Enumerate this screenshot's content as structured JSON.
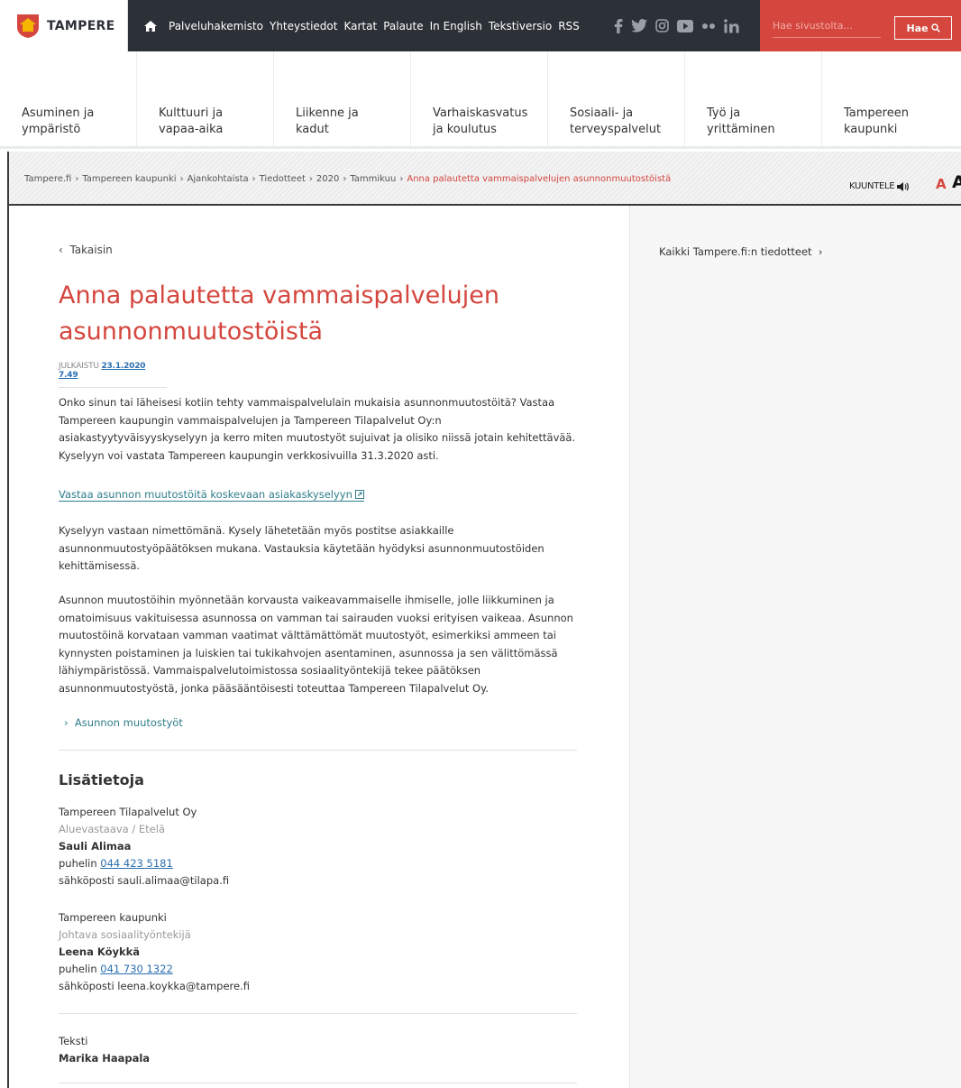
{
  "header": {
    "logo_text": "TAMPERE",
    "top_links": [
      "Palveluhakemisto",
      "Yhteystiedot",
      "Kartat",
      "Palaute",
      "In English",
      "Tekstiversio",
      "RSS"
    ],
    "search_placeholder": "Hae sivustolta...",
    "search_button": "Hae",
    "colors": {
      "topbar": "#2c3037",
      "search_bg": "#d4463e"
    }
  },
  "nav": {
    "items": [
      {
        "line1": "Asuminen ja",
        "line2": "ympäristö"
      },
      {
        "line1": "Kulttuuri ja",
        "line2": "vapaa-aika"
      },
      {
        "line1": "Liikenne ja",
        "line2": "kadut"
      },
      {
        "line1": "Varhaiskasvatus",
        "line2": "ja koulutus"
      },
      {
        "line1": "Sosiaali- ja",
        "line2": "terveyspalvelut"
      },
      {
        "line1": "Työ ja",
        "line2": "yrittäminen"
      },
      {
        "line1": "Tampereen",
        "line2": "kaupunki"
      }
    ]
  },
  "breadcrumb": {
    "items": [
      "Tampere.fi",
      "Tampereen kaupunki",
      "Ajankohtaista",
      "Tiedotteet",
      "2020",
      "Tammikuu"
    ],
    "current": "Anna palautetta vammaispalvelujen asunnonmuutostöistä",
    "listen": "KUUNTELE",
    "font_small": "A",
    "font_large": "A"
  },
  "article": {
    "back": "Takaisin",
    "title": "Anna palautetta vammaispalvelujen asunnonmuutostöistä",
    "published_label": "JULKAISTU",
    "published_date": "23.1.2020 7.49",
    "para1": "Onko sinun tai läheisesi kotiin tehty vammaispalvelulain mukaisia asunnonmuutostöitä? Vastaa Tampereen kaupungin vammaispalvelujen ja Tampereen Tilapalvelut Oy:n asiakastyytyväisyyskyselyyn ja kerro miten muutostyöt sujuivat ja olisiko niissä jotain kehitettävää. Kyselyyn voi vastata Tampereen kaupungin verkkosivuilla 31.3.2020 asti.",
    "survey_link": "Vastaa asunnon muutostöitä koskevaan asiakaskyselyyn",
    "para2": "Kyselyyn vastaan nimettömänä. Kysely lähetetään myös postitse asiakkaille asunnonmuutostyöpäätöksen mukana. Vastauksia käytetään hyödyksi asunnonmuutostöiden kehittämisessä.",
    "para3": "Asunnon muutostöihin myönnetään korvausta vaikeavammaiselle ihmiselle, jolle liikkuminen ja omatoimisuus vakituisessa asunnossa on vamman tai sairauden vuoksi erityisen vaikeaa. Asunnon muutostöinä korvataan vamman vaatimat välttämättömät muutostyöt, esimerkiksi ammeen tai kynnysten poistaminen ja luiskien tai tukikahvojen asentaminen, asunnossa ja sen välittömässä lähiympäristössä. Vammaispalvelutoimistossa sosiaalityöntekijä tekee päätöksen asunnonmuutostyöstä, jonka pääsääntöisesti toteuttaa Tampereen Tilapalvelut Oy.",
    "more_link": "Asunnon muutostyöt",
    "subhead": "Lisätietoja",
    "contacts": [
      {
        "org": "Tampereen Tilapalvelut Oy",
        "role": "Aluevastaava / Etelä",
        "name": "Sauli Alimaa",
        "phone_label": "puhelin",
        "phone": "044 423 5181",
        "email_line": "sähköposti sauli.alimaa@tilapa.fi"
      },
      {
        "org": "Tampereen kaupunki",
        "role": "Johtava sosiaalityöntekijä",
        "name": "Leena Köykkä",
        "phone_label": "puhelin",
        "phone": "041 730 1322",
        "email_line": "sähköposti leena.koykka@tampere.fi"
      }
    ],
    "text_label": "Teksti",
    "text_author": "Marika Haapala"
  },
  "sidebar": {
    "link": "Kaikki Tampere.fi:n tiedotteet"
  }
}
